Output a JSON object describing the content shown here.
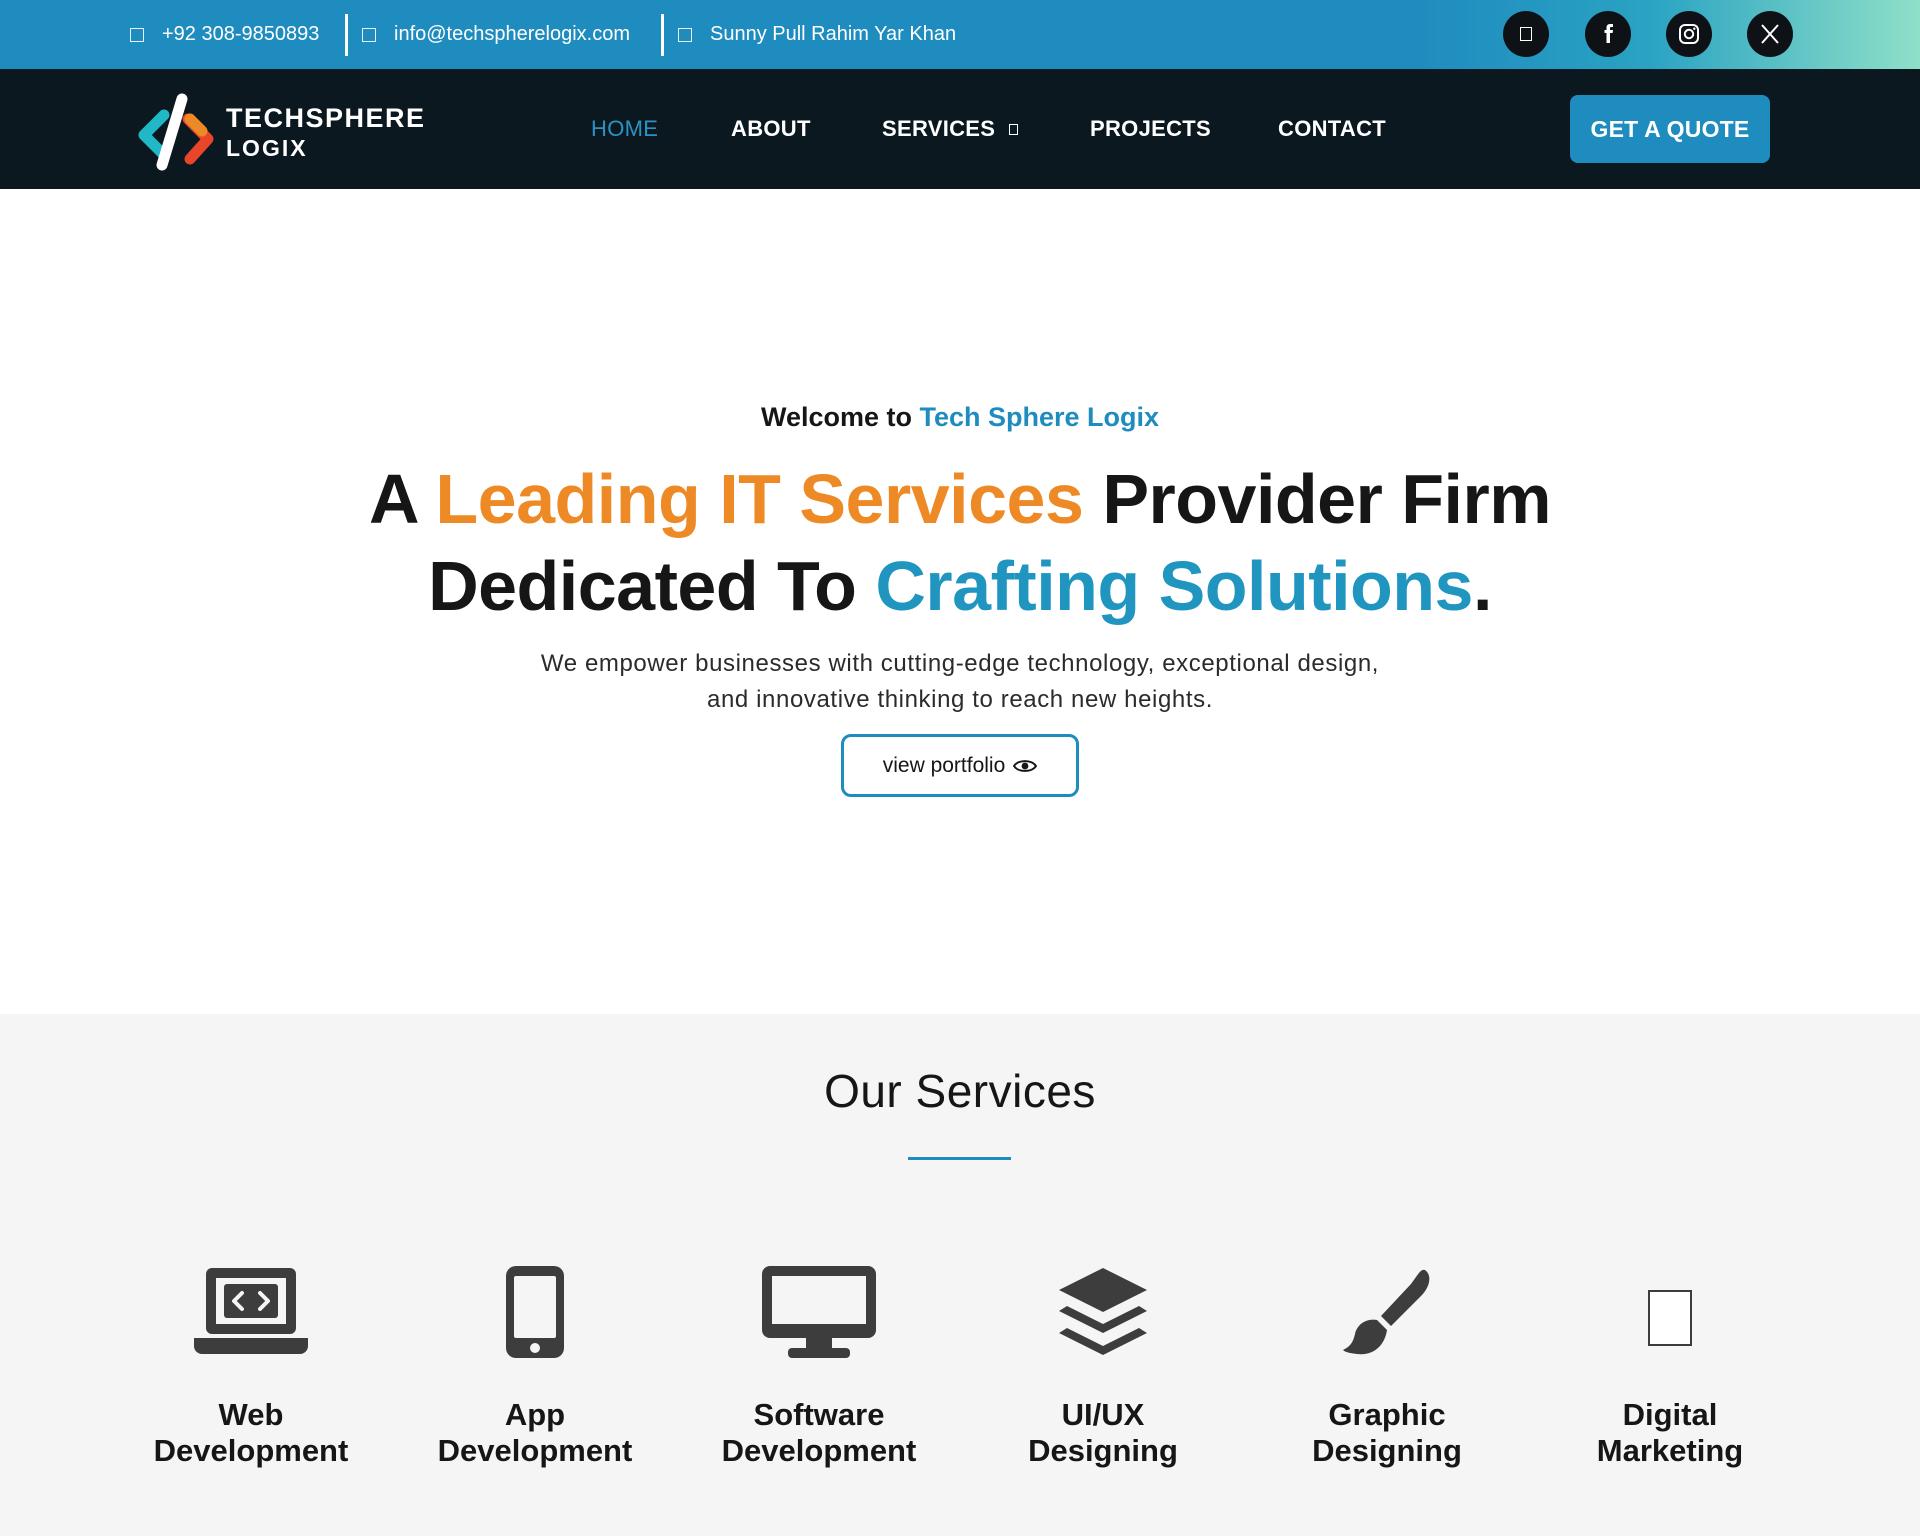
{
  "topbar": {
    "phone": "+92 308-9850893",
    "email": "info@techspherelogix.com",
    "address": "Sunny Pull Rahim Yar Khan",
    "socials": [
      "unknown-social-icon",
      "facebook-icon",
      "instagram-icon",
      "x-icon"
    ]
  },
  "brand": {
    "line1": "TECHSPHERE",
    "line2": "LOGIX"
  },
  "nav": {
    "home": "HOME",
    "about": "ABOUT",
    "services": "SERVICES",
    "projects": "PROJECTS",
    "contact": "CONTACT",
    "quote": "GET A QUOTE"
  },
  "hero": {
    "welcome_prefix": "Welcome to",
    "welcome_brand": "Tech Sphere Logix",
    "line1_a": "A ",
    "line1_highlight": "Leading IT Services",
    "line1_b": " Provider Firm",
    "line2_a": "Dedicated To ",
    "line2_highlight": "Crafting Solutions",
    "line2_b": ".",
    "sub1": "We empower businesses with cutting-edge technology, exceptional design,",
    "sub2": "and innovative thinking to reach new heights.",
    "cta": "view portfolio"
  },
  "services": {
    "title": "Our Services",
    "items": [
      {
        "line1": "Web",
        "line2": "Development",
        "icon": "laptop-code-icon"
      },
      {
        "line1": "App",
        "line2": "Development",
        "icon": "mobile-icon"
      },
      {
        "line1": "Software",
        "line2": "Development",
        "icon": "desktop-icon"
      },
      {
        "line1": "UI/UX",
        "line2": "Designing",
        "icon": "layers-icon"
      },
      {
        "line1": "Graphic",
        "line2": "Designing",
        "icon": "paintbrush-icon"
      },
      {
        "line1": "Digital",
        "line2": "Marketing",
        "icon": "missing-icon"
      }
    ]
  },
  "colors": {
    "accent_blue": "#1f8cbf",
    "accent_orange": "#ee8a25",
    "nav_bg": "#0b1820",
    "services_bg": "#f5f5f5"
  }
}
